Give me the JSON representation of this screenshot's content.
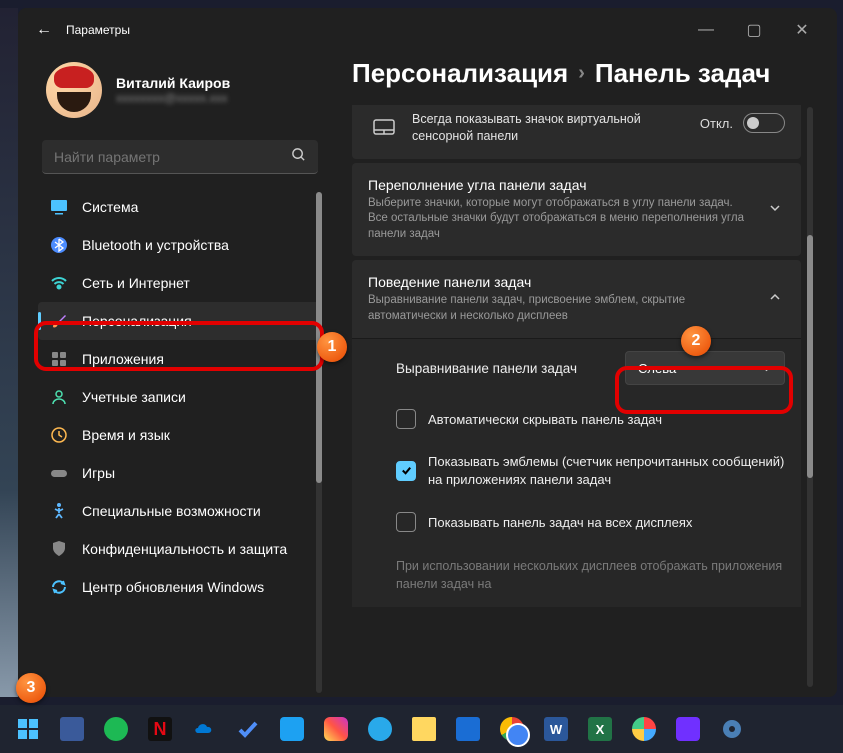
{
  "window": {
    "title": "Параметры",
    "min": "—",
    "max": "▢",
    "close": "✕"
  },
  "user": {
    "name": "Виталий Каиров",
    "email": "xxxxxxxx@xxxxx.xxx"
  },
  "search": {
    "placeholder": "Найти параметр"
  },
  "sidebar": {
    "items": [
      {
        "label": "Система"
      },
      {
        "label": "Bluetooth и устройства"
      },
      {
        "label": "Сеть и Интернет"
      },
      {
        "label": "Персонализация"
      },
      {
        "label": "Приложения"
      },
      {
        "label": "Учетные записи"
      },
      {
        "label": "Время и язык"
      },
      {
        "label": "Игры"
      },
      {
        "label": "Специальные возможности"
      },
      {
        "label": "Конфиденциальность и защита"
      },
      {
        "label": "Центр обновления Windows"
      }
    ]
  },
  "breadcrumb": {
    "parent": "Персонализация",
    "sep": "›",
    "current": "Панель задач"
  },
  "panel": {
    "touchpad": {
      "text": "Всегда показывать значок виртуальной сенсорной панели",
      "state": "Откл."
    },
    "overflow": {
      "title": "Переполнение угла панели задач",
      "desc": "Выберите значки, которые могут отображаться в углу панели задач. Все остальные значки будут отображаться в меню переполнения угла панели задач"
    },
    "behavior": {
      "title": "Поведение панели задач",
      "desc": "Выравнивание панели задач, присвоение эмблем, скрытие автоматически и несколько дисплеев",
      "align_label": "Выравнивание панели задач",
      "align_value": "Слева",
      "autohide": "Автоматически скрывать панель задач",
      "badges": "Показывать эмблемы (счетчик непрочитанных сообщений) на приложениях панели задач",
      "alldisplays": "Показывать панель задач на всех дисплеях",
      "multimon": "При использовании нескольких дисплеев отображать приложения панели задач на"
    }
  },
  "badges": {
    "1": "1",
    "2": "2",
    "3": "3"
  }
}
